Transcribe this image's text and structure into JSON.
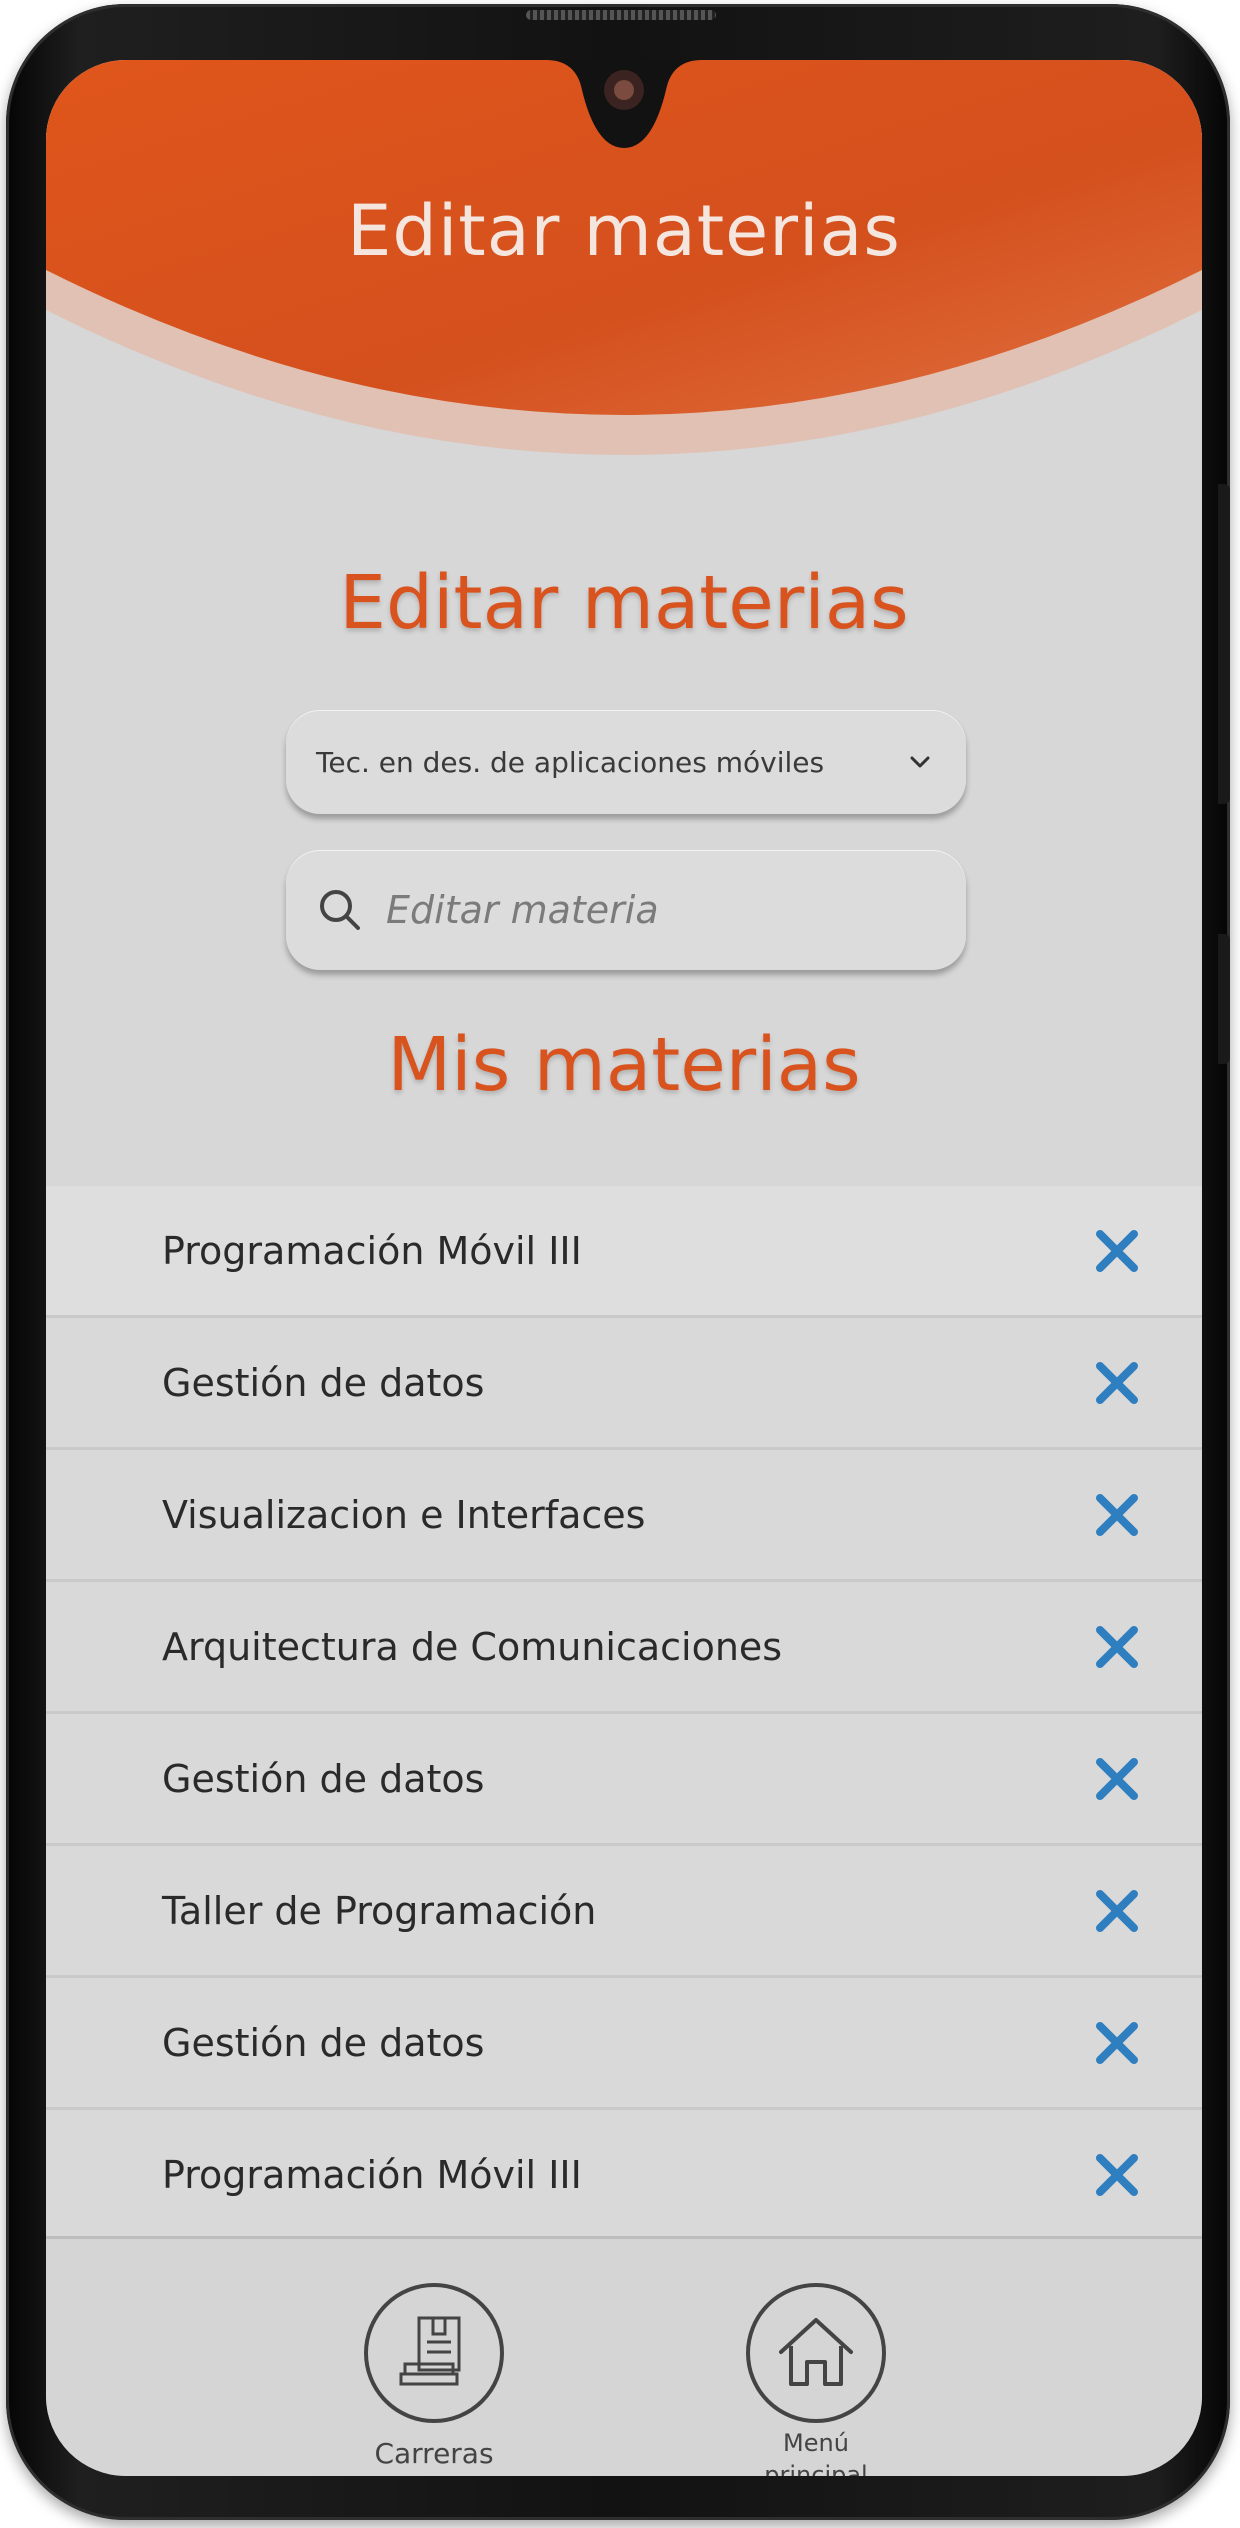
{
  "header": {
    "title": "Editar materias"
  },
  "page": {
    "section_title": "Editar materias",
    "list_title": "Mis materias"
  },
  "career_select": {
    "selected": "Tec. en des. de aplicaciones móviles"
  },
  "search": {
    "placeholder": "Editar materia"
  },
  "subjects": [
    {
      "label": "Programación Móvil III"
    },
    {
      "label": "Gestión de datos"
    },
    {
      "label": "Visualizacion e Interfaces"
    },
    {
      "label": "Arquitectura de Comunicaciones"
    },
    {
      "label": "Gestión de datos"
    },
    {
      "label": "Taller de Programación"
    },
    {
      "label": "Gestión de datos"
    },
    {
      "label": "Programación Móvil III"
    }
  ],
  "bottom_nav": {
    "carreras_label": "Carreras",
    "menu_label": "Menú principal"
  },
  "icons": {
    "remove": "close-icon",
    "careers": "book-icon",
    "home": "home-icon",
    "search": "search-icon",
    "dropdown": "chevron-down-icon"
  },
  "colors": {
    "header_orange": "#d9531e",
    "header_orange_light": "#e06a3c",
    "accent_text": "#d9531e",
    "remove_blue": "#2f7fc0",
    "background": "#d7d7d7"
  }
}
